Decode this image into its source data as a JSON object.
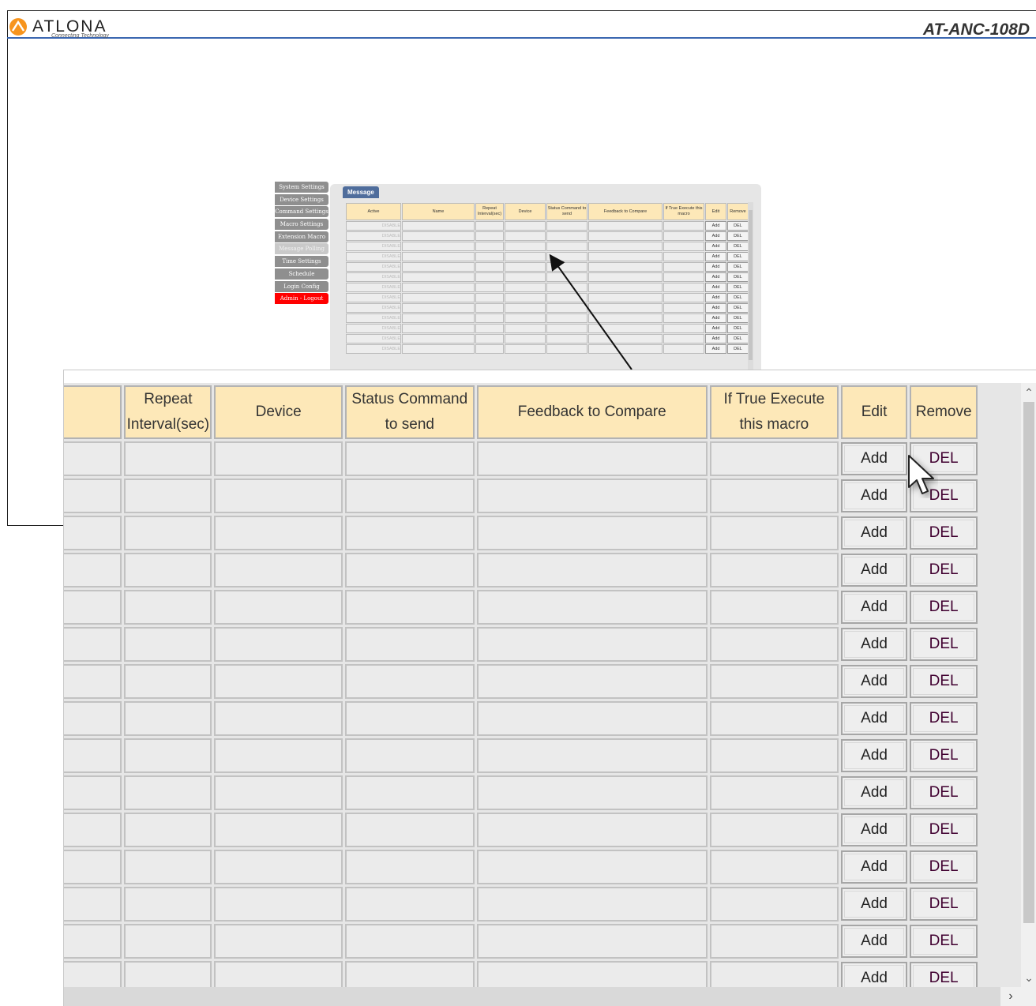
{
  "header": {
    "brand": "ATLONA",
    "tagline": "Connecting Technology",
    "product": "AT-ANC-108D"
  },
  "mini_nav": [
    {
      "label": "System Settings"
    },
    {
      "label": "Device Settings"
    },
    {
      "label": "Command Settings"
    },
    {
      "label": "Macro Settings"
    },
    {
      "label": "Extension Macro"
    },
    {
      "label": "Message Polling"
    },
    {
      "label": "Time Settings"
    },
    {
      "label": "Schedule"
    },
    {
      "label": "Login Config"
    },
    {
      "label": "Admin - Logout"
    }
  ],
  "mini_panel": {
    "tab": "Message",
    "columns": [
      "Active",
      "Name",
      "Repeat Interval(sec)",
      "Device",
      "Status Command to send",
      "Feedback to Compare",
      "If True Execute this macro",
      "Edit",
      "Remove"
    ],
    "active_value": "DISABLE",
    "edit_label": "Add",
    "remove_label": "DEL"
  },
  "zoom_table": {
    "columns": [
      "Repeat Interval(sec)",
      "Device",
      "Status Command to send",
      "Feedback to Compare",
      "If True Execute this macro",
      "Edit",
      "Remove"
    ],
    "edit_label": "Add",
    "remove_label": "DEL"
  },
  "scrollbar": {
    "up": "^",
    "down": "v",
    "right": ">"
  }
}
